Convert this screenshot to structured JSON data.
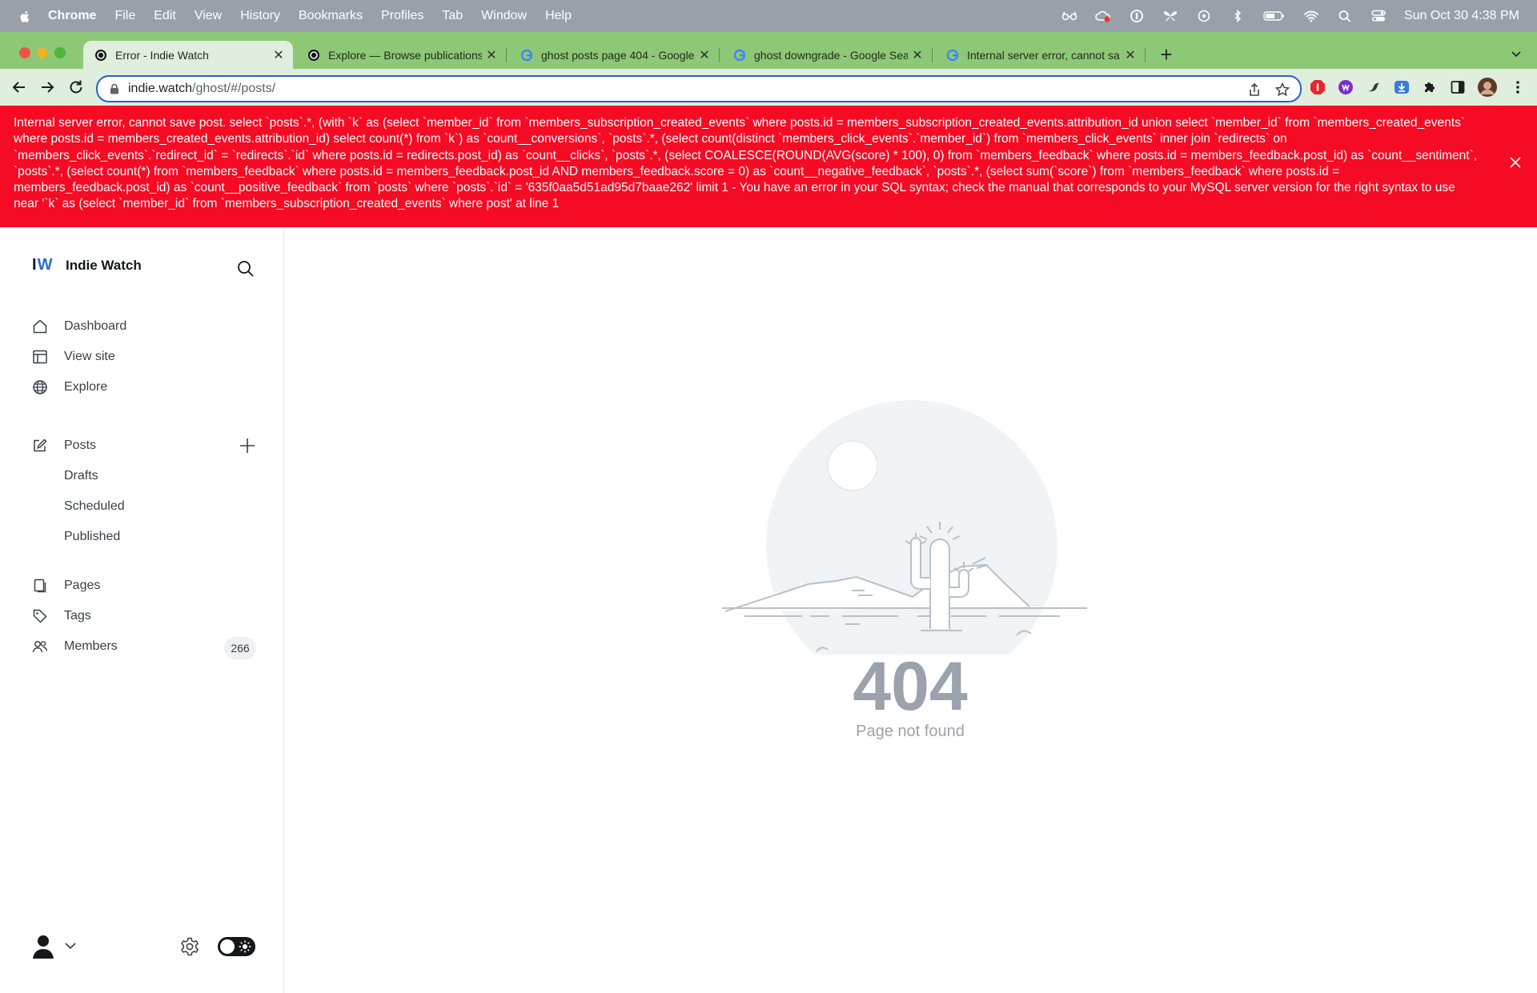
{
  "menubar": {
    "app": "Chrome",
    "items": [
      "File",
      "Edit",
      "View",
      "History",
      "Bookmarks",
      "Profiles",
      "Tab",
      "Window",
      "Help"
    ],
    "clock": "Sun Oct 30  4:38 PM"
  },
  "tabs": [
    {
      "title": "Error - Indie Watch",
      "icon": "ghost-icon",
      "active": true
    },
    {
      "title": "Explore — Browse publications",
      "icon": "ghost-icon",
      "active": false
    },
    {
      "title": "ghost posts page 404 - Google",
      "icon": "google-icon",
      "active": false
    },
    {
      "title": "ghost downgrade - Google Sea",
      "icon": "google-icon",
      "active": false
    },
    {
      "title": "Internal server error, cannot sa",
      "icon": "google-icon",
      "active": false
    }
  ],
  "address": {
    "host": "indie.watch",
    "path": "/ghost/#/posts/"
  },
  "error": {
    "message": "Internal server error, cannot save post. select `posts`.*, (with `k` as (select `member_id` from `members_subscription_created_events` where posts.id = members_subscription_created_events.attribution_id union select `member_id` from `members_created_events` where posts.id = members_created_events.attribution_id) select count(*) from `k`) as `count__conversions`, `posts`.*, (select count(distinct `members_click_events`.`member_id`) from `members_click_events` inner join `redirects` on `members_click_events`.`redirect_id` = `redirects`.`id` where posts.id = redirects.post_id) as `count__clicks`, `posts`.*, (select COALESCE(ROUND(AVG(score) * 100), 0) from `members_feedback` where posts.id = members_feedback.post_id) as `count__sentiment`, `posts`.*, (select count(*) from `members_feedback` where posts.id = members_feedback.post_id AND members_feedback.score = 0) as `count__negative_feedback`, `posts`.*, (select sum(`score`) from `members_feedback` where posts.id = members_feedback.post_id) as `count__positive_feedback` from `posts` where `posts`.`id` = '635f0aa5d51ad95d7baae262' limit 1 - You have an error in your SQL syntax; check the manual that corresponds to your MySQL server version for the right syntax to use near '`k` as (select `member_id` from `members_subscription_created_events` where post' at line 1"
  },
  "sidebar": {
    "logo_i": "I",
    "logo_w": "W",
    "site_name": "Indie Watch",
    "dashboard": "Dashboard",
    "view_site": "View site",
    "explore": "Explore",
    "posts": "Posts",
    "drafts": "Drafts",
    "scheduled": "Scheduled",
    "published": "Published",
    "pages": "Pages",
    "tags": "Tags",
    "members": "Members",
    "members_count": "266"
  },
  "main": {
    "code": "404",
    "message": "Page not found"
  },
  "colors": {
    "error_bg": "#f50b23",
    "tab_strip": "#8dc877",
    "brand_accent": "#2b6bd4"
  }
}
